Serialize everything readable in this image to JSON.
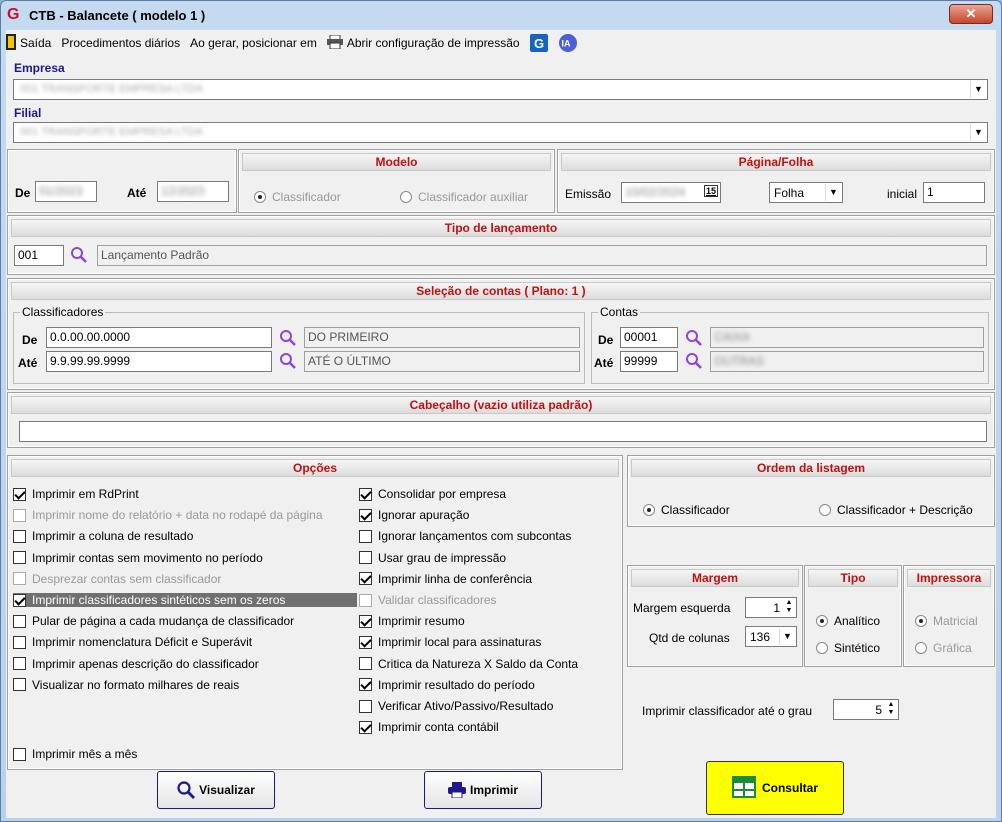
{
  "window": {
    "title": "CTB - Balancete  ( modelo 1 )",
    "close": "✕"
  },
  "menu": {
    "exit": "Saída",
    "daily": "Procedimentos diários",
    "position": "Ao gerar, posicionar em",
    "print_config": "Abrir configuração de impressão",
    "ia": "IA"
  },
  "empresa": {
    "label": "Empresa",
    "value": "001 TRANSPORTE EMPRESA LTDA"
  },
  "filial": {
    "label": "Filial",
    "value": "001 TRANSPORTE EMPRESA LTDA"
  },
  "periodo": {
    "de_label": "De",
    "ate_label": "Até",
    "de_value": "01/2023",
    "ate_value": "12/2023"
  },
  "modelo": {
    "header": "Modelo",
    "opt1": "Classificador",
    "opt2": "Classificador auxiliar"
  },
  "pagina": {
    "header": "Página/Folha",
    "emissao_label": "Emissão",
    "emissao_value": "10/02/2024",
    "cal_icon": "15",
    "tipo": "Folha",
    "inicial_label": "inicial",
    "inicial_value": "1"
  },
  "tipo_lanc": {
    "header": "Tipo de lançamento",
    "code": "001",
    "desc": "Lançamento Padrão"
  },
  "selecao": {
    "header": "Seleção de contas  ( Plano: 1 )",
    "class_title": "Classificadores",
    "de_label": "De",
    "ate_label": "Até",
    "class_de": "0.0.00.00.0000",
    "class_de_desc": "DO PRIMEIRO",
    "class_ate": "9.9.99.99.9999",
    "class_ate_desc": "ATÉ O ÚLTIMO",
    "contas_title": "Contas",
    "conta_de": "00001",
    "conta_ate": "99999",
    "conta_de_desc": "CAIXA",
    "conta_ate_desc": "OUTRAS"
  },
  "cabecalho": {
    "header": "Cabeçalho (vazio utiliza padrão)",
    "value": ""
  },
  "opcoes": {
    "header": "Opções",
    "left": [
      {
        "label": "Imprimir em RdPrint",
        "checked": true
      },
      {
        "label": "Imprimir nome do relatório + data no rodapé da página",
        "checked": false
      },
      {
        "label": "Imprimir a coluna de resultado",
        "checked": false
      },
      {
        "label": "Imprimir contas sem movimento no período",
        "checked": false
      },
      {
        "label": "Desprezar contas sem classificador",
        "checked": false
      },
      {
        "label": "Imprimir classificadores sintéticos sem os zeros",
        "checked": true
      },
      {
        "label": "Pular de página a cada mudança de classificador",
        "checked": false
      },
      {
        "label": "Imprimir nomenclatura Déficit e Superávit",
        "checked": false
      },
      {
        "label": "Imprimir apenas descrição do classificador",
        "checked": false
      },
      {
        "label": "Visualizar no formato milhares de reais",
        "checked": false
      },
      {
        "label": "Imprimir mês a mês",
        "checked": false
      }
    ],
    "right": [
      {
        "label": "Consolidar por empresa",
        "checked": true
      },
      {
        "label": "Ignorar apuração",
        "checked": true
      },
      {
        "label": "Ignorar lançamentos com subcontas",
        "checked": false
      },
      {
        "label": "Usar grau de impressão",
        "checked": false
      },
      {
        "label": "Imprimir linha de conferência",
        "checked": true
      },
      {
        "label": "Validar classificadores",
        "checked": false
      },
      {
        "label": "Imprimir resumo",
        "checked": true
      },
      {
        "label": "Imprimir local para assinaturas",
        "checked": true
      },
      {
        "label": "Critica da Natureza X Saldo da Conta",
        "checked": false
      },
      {
        "label": "Imprimir resultado do período",
        "checked": true
      },
      {
        "label": "Verificar Ativo/Passivo/Resultado",
        "checked": false
      },
      {
        "label": "Imprimir conta contábil",
        "checked": true
      }
    ]
  },
  "ordem": {
    "header": "Ordem da listagem",
    "opt1": "Classificador",
    "opt2": "Classificador + Descrição"
  },
  "margem": {
    "header": "Margem",
    "esq_label": "Margem esquerda",
    "esq_value": "1",
    "cols_label": "Qtd de colunas",
    "cols_value": "136"
  },
  "tipo": {
    "header": "Tipo",
    "opt1": "Analítico",
    "opt2": "Sintético"
  },
  "impressora": {
    "header": "Impressora",
    "opt1": "Matricial",
    "opt2": "Gráfica"
  },
  "grau": {
    "label": "Imprimir classificador até o grau",
    "value": "5"
  },
  "buttons": {
    "visualizar": "Visualizar",
    "imprimir": "Imprimir",
    "consultar": "Consultar"
  }
}
